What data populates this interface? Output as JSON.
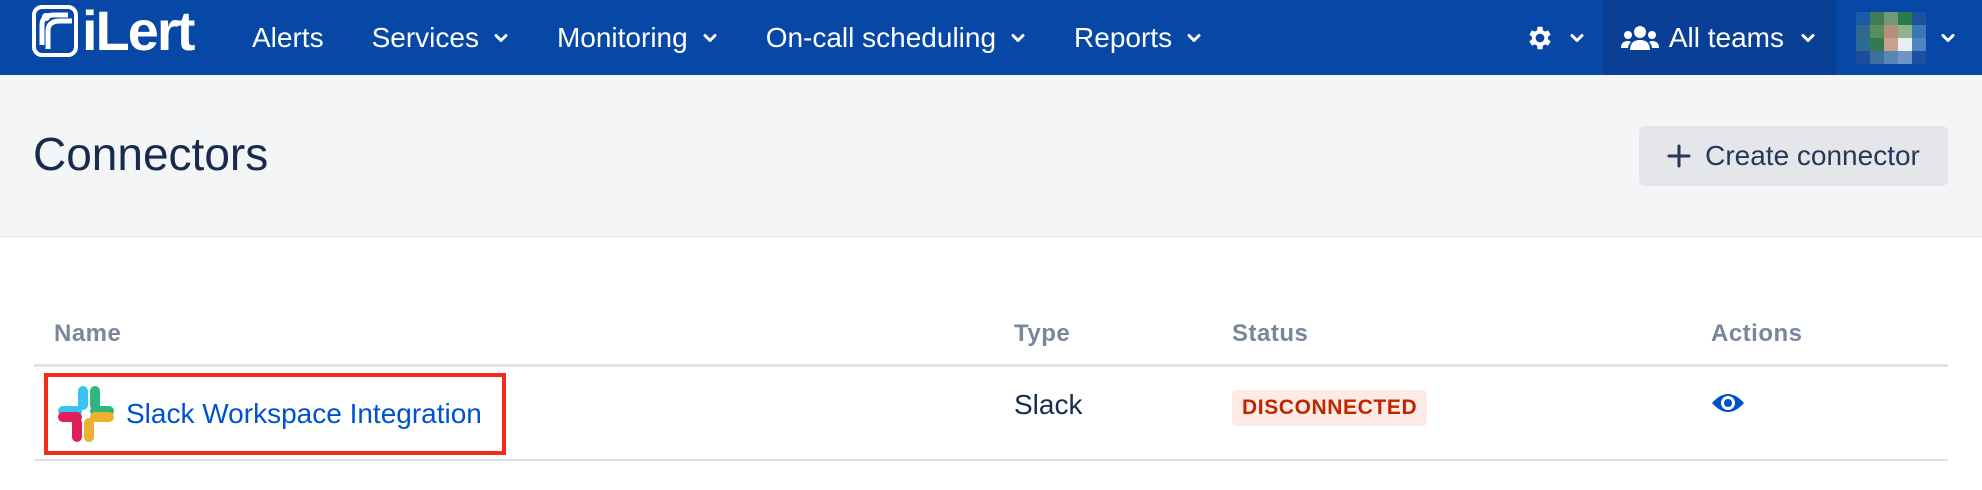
{
  "app": {
    "logo_text": "iLert"
  },
  "nav": {
    "items": [
      {
        "label": "Alerts",
        "has_dropdown": false
      },
      {
        "label": "Services",
        "has_dropdown": true
      },
      {
        "label": "Monitoring",
        "has_dropdown": true
      },
      {
        "label": "On-call scheduling",
        "has_dropdown": true
      },
      {
        "label": "Reports",
        "has_dropdown": true
      }
    ],
    "settings_icon": "gear-icon",
    "teams_label": "All teams",
    "teams_icon": "users-icon"
  },
  "page": {
    "title": "Connectors",
    "create_button_label": "Create connector"
  },
  "table": {
    "columns": [
      "Name",
      "Type",
      "Status",
      "Actions"
    ],
    "rows": [
      {
        "name": "Slack Workspace Integration",
        "type": "Slack",
        "status": "DISCONNECTED",
        "action_icon": "eye-icon"
      }
    ]
  },
  "colors": {
    "nav_background": "#0747a6",
    "link": "#0052cc",
    "status_text": "#bf2600",
    "status_background": "#ffebe6",
    "highlight_border": "#f22e18"
  }
}
